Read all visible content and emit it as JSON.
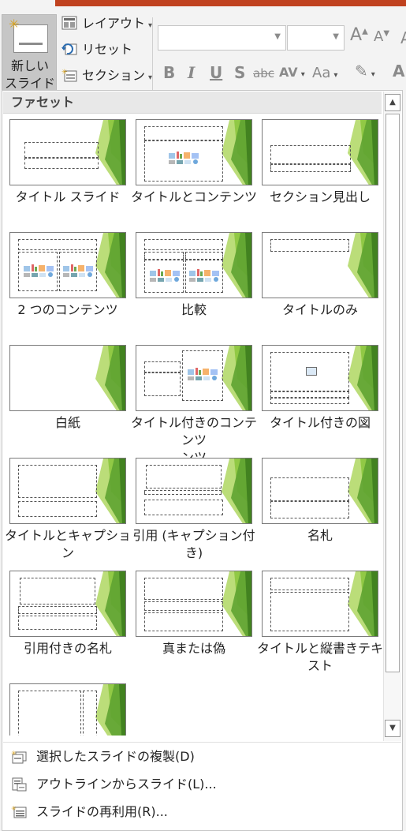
{
  "ribbon": {
    "new_slide_label_1": "新しい",
    "new_slide_label_2": "スライド",
    "layout_label": "レイアウト",
    "reset_label": "リセット",
    "section_label": "セクション",
    "font_buttons": [
      "B",
      "I",
      "U",
      "S",
      "abc",
      "AV",
      "Aa"
    ],
    "grow_label": "A",
    "shrink_label": "A",
    "accent_color": "#c0421f"
  },
  "gallery": {
    "header": "ファセット",
    "layouts": [
      {
        "label": "タイトル スライド",
        "kind": "title"
      },
      {
        "label": "タイトルとコンテンツ",
        "kind": "title-content"
      },
      {
        "label": "セクション見出し",
        "kind": "section"
      },
      {
        "label": "2 つのコンテンツ",
        "kind": "two-content"
      },
      {
        "label": "比較",
        "kind": "comparison"
      },
      {
        "label": "タイトルのみ",
        "kind": "title-only"
      },
      {
        "label": "白紙",
        "kind": "blank"
      },
      {
        "label": "タイトル付きのコンテンツ",
        "label2": "ンツ",
        "kind": "content-caption"
      },
      {
        "label": "タイトル付きの図",
        "kind": "picture-caption"
      },
      {
        "label": "タイトルとキャプション",
        "kind": "title-caption"
      },
      {
        "label": "引用 (キャプション付",
        "label2": "き)",
        "kind": "quote-caption"
      },
      {
        "label": "名札",
        "kind": "name-card"
      },
      {
        "label": "引用付きの名札",
        "kind": "quote-name-card"
      },
      {
        "label": "真または偽",
        "kind": "true-false"
      },
      {
        "label": "タイトルと縦書きテキ",
        "label2": "スト",
        "kind": "vertical-text"
      },
      {
        "label": "",
        "kind": "vertical-title"
      }
    ],
    "theme_greens": [
      "#8dc63f",
      "#5fa331",
      "#b4d96a",
      "#3e7e1e"
    ]
  },
  "menu": {
    "items": [
      {
        "label": "選択したスライドの複製(D)",
        "icon": "duplicate-slide-icon"
      },
      {
        "label": "アウトラインからスライド(L)...",
        "icon": "outline-slides-icon"
      },
      {
        "label": "スライドの再利用(R)...",
        "icon": "reuse-slides-icon"
      }
    ]
  }
}
